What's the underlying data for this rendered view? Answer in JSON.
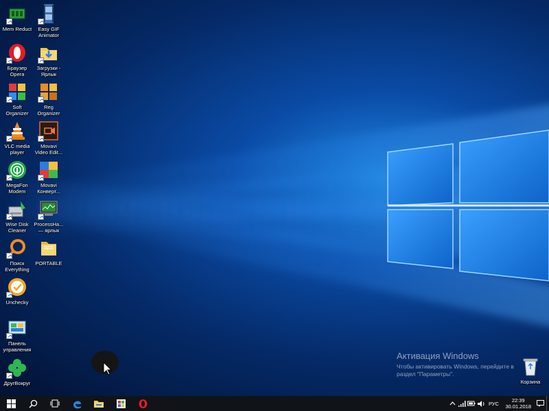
{
  "desktop_icons": [
    {
      "label": "Mem Reduct",
      "icon": "mem-reduct-icon"
    },
    {
      "label": "Easy GIF\nAnimator",
      "icon": "film-icon"
    },
    {
      "label": "Браузер\nOpera",
      "icon": "opera-icon"
    },
    {
      "label": "Загрузки -\nЯрлык",
      "icon": "folder-download-icon"
    },
    {
      "label": "Soft\nOrganizer",
      "icon": "puzzle-icon"
    },
    {
      "label": "Reg\nOrganizer",
      "icon": "puzzle-icon"
    },
    {
      "label": "VLC media\nplayer",
      "icon": "vlc-cone-icon"
    },
    {
      "label": "Movavi\nVideo Edit...",
      "icon": "movavi-editor-icon"
    },
    {
      "label": "MegaFon\nModem",
      "icon": "modem-icon"
    },
    {
      "label": "Movavi\nКонверт...",
      "icon": "movavi-converter-icon"
    },
    {
      "label": "Wise Disk\nCleaner",
      "icon": "disk-cleaner-icon"
    },
    {
      "label": "ProcessHa...\n— ярлык",
      "icon": "process-hacker-icon"
    },
    {
      "label": "Поиск\nEverything",
      "icon": "search-ring-icon"
    },
    {
      "label": "PORTABLE",
      "icon": "folder-icon"
    },
    {
      "label": "Unchecky",
      "icon": "unchecky-icon"
    },
    {
      "label": "Панель\nуправления",
      "icon": "control-panel-icon"
    },
    {
      "label": "ДругВокруг",
      "icon": "clover-icon"
    },
    {
      "label": "Корзина",
      "icon": "recycle-bin-icon"
    }
  ],
  "activation": {
    "title": "Активация Windows",
    "text": "Чтобы активировать Windows, перейдите в раздел \"Параметры\"."
  },
  "taskbar": {
    "pinned": [
      "windows-start-icon",
      "search-icon",
      "task-view-icon",
      "edge-icon",
      "file-explorer-icon",
      "store-icon",
      "opera-icon"
    ],
    "language": "РУС",
    "time": "22:39",
    "date": "30.01.2018"
  }
}
